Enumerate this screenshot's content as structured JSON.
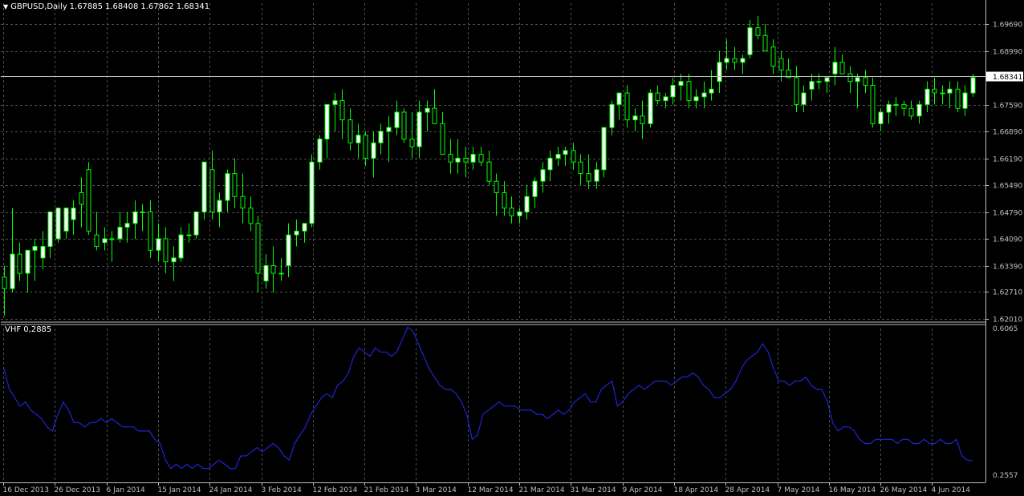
{
  "header": {
    "menu_icon": "triangle-down-icon",
    "symbol": "GBPUSD,Daily",
    "open": "1.67885",
    "high": "1.68408",
    "low": "1.67862",
    "close": "1.68341"
  },
  "indicator": {
    "name": "VHF",
    "value": "0.2885",
    "label": "VHF 0,2885",
    "scale_top": "0.6065",
    "scale_bottom": "0.2557"
  },
  "colors": {
    "background": "#000000",
    "grid": "#4f4f4f",
    "axis": "#c0c0c0",
    "candle_up": "#ffffff",
    "candle_down": "#000000",
    "wick": "#00ff00",
    "bid_line": "#c0c0c0",
    "indicator_line": "#2323d2",
    "price_label_bg": "#ffffff"
  },
  "price_axis": {
    "ticks": [
      "1.69690",
      "1.68990",
      "1.67590",
      "1.66890",
      "1.66190",
      "1.65490",
      "1.64790",
      "1.64090",
      "1.63390",
      "1.62710",
      "1.62010"
    ],
    "current_price_label": "1.68341"
  },
  "time_axis": {
    "labels": [
      "16 Dec 2013",
      "26 Dec 2013",
      "6 Jan 2014",
      "15 Jan 2014",
      "24 Jan 2014",
      "3 Feb 2014",
      "12 Feb 2014",
      "21 Feb 2014",
      "3 Mar 2014",
      "12 Mar 2014",
      "21 Mar 2014",
      "31 Mar 2014",
      "9 Apr 2014",
      "18 Apr 2014",
      "28 Apr 2014",
      "7 May 2014",
      "16 May 2014",
      "26 May 2014",
      "4 Jun 2014"
    ]
  },
  "chart_data": [
    {
      "type": "candlestick",
      "title": "GBPUSD,Daily",
      "ylim": [
        1.6201,
        1.6999
      ],
      "current_price": 1.68341,
      "grid": true,
      "candles": [
        [
          1.631,
          1.634,
          1.621,
          1.628
        ],
        [
          1.628,
          1.649,
          1.627,
          1.637
        ],
        [
          1.637,
          1.64,
          1.63,
          1.632
        ],
        [
          1.632,
          1.636,
          1.627,
          1.638
        ],
        [
          1.638,
          1.641,
          1.63,
          1.639
        ],
        [
          1.636,
          1.643,
          1.633,
          1.639
        ],
        [
          1.639,
          1.645,
          1.636,
          1.648
        ],
        [
          1.641,
          1.648,
          1.64,
          1.649
        ],
        [
          1.643,
          1.646,
          1.641,
          1.649
        ],
        [
          1.646,
          1.651,
          1.642,
          1.649
        ],
        [
          1.653,
          1.657,
          1.644,
          1.65
        ],
        [
          1.659,
          1.661,
          1.642,
          1.643
        ],
        [
          1.642,
          1.648,
          1.638,
          1.639
        ],
        [
          1.64,
          1.644,
          1.638,
          1.641
        ],
        [
          1.641,
          1.643,
          1.635,
          1.641
        ],
        [
          1.641,
          1.648,
          1.64,
          1.644
        ],
        [
          1.644,
          1.648,
          1.64,
          1.645
        ],
        [
          1.645,
          1.651,
          1.641,
          1.648
        ],
        [
          1.648,
          1.65,
          1.643,
          1.648
        ],
        [
          1.648,
          1.651,
          1.636,
          1.638
        ],
        [
          1.638,
          1.645,
          1.635,
          1.641
        ],
        [
          1.641,
          1.644,
          1.632,
          1.635
        ],
        [
          1.635,
          1.639,
          1.63,
          1.636
        ],
        [
          1.636,
          1.644,
          1.635,
          1.642
        ],
        [
          1.642,
          1.645,
          1.64,
          1.642
        ],
        [
          1.642,
          1.647,
          1.641,
          1.648
        ],
        [
          1.648,
          1.661,
          1.646,
          1.661
        ],
        [
          1.659,
          1.664,
          1.646,
          1.648
        ],
        [
          1.648,
          1.653,
          1.644,
          1.651
        ],
        [
          1.651,
          1.659,
          1.648,
          1.658
        ],
        [
          1.658,
          1.662,
          1.649,
          1.652
        ],
        [
          1.652,
          1.658,
          1.645,
          1.649
        ],
        [
          1.649,
          1.652,
          1.643,
          1.645
        ],
        [
          1.645,
          1.647,
          1.627,
          1.632
        ],
        [
          1.63,
          1.637,
          1.628,
          1.634
        ],
        [
          1.634,
          1.639,
          1.627,
          1.632
        ],
        [
          1.632,
          1.636,
          1.63,
          1.632
        ],
        [
          1.634,
          1.645,
          1.631,
          1.642
        ],
        [
          1.642,
          1.646,
          1.639,
          1.643
        ],
        [
          1.643,
          1.645,
          1.64,
          1.645
        ],
        [
          1.645,
          1.663,
          1.644,
          1.661
        ],
        [
          1.661,
          1.668,
          1.659,
          1.667
        ],
        [
          1.667,
          1.676,
          1.662,
          1.676
        ],
        [
          1.676,
          1.679,
          1.669,
          1.677
        ],
        [
          1.677,
          1.68,
          1.667,
          1.672
        ],
        [
          1.672,
          1.675,
          1.664,
          1.666
        ],
        [
          1.666,
          1.671,
          1.662,
          1.668
        ],
        [
          1.668,
          1.669,
          1.66,
          1.662
        ],
        [
          1.662,
          1.669,
          1.657,
          1.666
        ],
        [
          1.666,
          1.671,
          1.663,
          1.669
        ],
        [
          1.669,
          1.673,
          1.661,
          1.67
        ],
        [
          1.67,
          1.677,
          1.668,
          1.674
        ],
        [
          1.674,
          1.675,
          1.666,
          1.667
        ],
        [
          1.667,
          1.674,
          1.662,
          1.665
        ],
        [
          1.665,
          1.677,
          1.662,
          1.674
        ],
        [
          1.674,
          1.677,
          1.669,
          1.675
        ],
        [
          1.675,
          1.68,
          1.672,
          1.671
        ],
        [
          1.671,
          1.674,
          1.664,
          1.663
        ],
        [
          1.663,
          1.667,
          1.658,
          1.661
        ],
        [
          1.661,
          1.667,
          1.658,
          1.662
        ],
        [
          1.662,
          1.665,
          1.657,
          1.661
        ],
        [
          1.661,
          1.665,
          1.659,
          1.663
        ],
        [
          1.663,
          1.665,
          1.66,
          1.661
        ],
        [
          1.661,
          1.664,
          1.655,
          1.656
        ],
        [
          1.656,
          1.658,
          1.647,
          1.653
        ],
        [
          1.653,
          1.656,
          1.647,
          1.649
        ],
        [
          1.649,
          1.652,
          1.645,
          1.647
        ],
        [
          1.647,
          1.649,
          1.645,
          1.648
        ],
        [
          1.648,
          1.655,
          1.646,
          1.652
        ],
        [
          1.652,
          1.657,
          1.649,
          1.656
        ],
        [
          1.656,
          1.661,
          1.653,
          1.659
        ],
        [
          1.659,
          1.664,
          1.656,
          1.662
        ],
        [
          1.662,
          1.665,
          1.66,
          1.663
        ],
        [
          1.663,
          1.665,
          1.66,
          1.664
        ],
        [
          1.664,
          1.666,
          1.659,
          1.661
        ],
        [
          1.661,
          1.663,
          1.655,
          1.658
        ],
        [
          1.658,
          1.663,
          1.654,
          1.656
        ],
        [
          1.656,
          1.661,
          1.654,
          1.659
        ],
        [
          1.659,
          1.67,
          1.657,
          1.67
        ],
        [
          1.67,
          1.677,
          1.668,
          1.676
        ],
        [
          1.676,
          1.679,
          1.672,
          1.679
        ],
        [
          1.679,
          1.681,
          1.67,
          1.672
        ],
        [
          1.672,
          1.675,
          1.669,
          1.673
        ],
        [
          1.673,
          1.677,
          1.667,
          1.671
        ],
        [
          1.671,
          1.68,
          1.67,
          1.679
        ],
        [
          1.679,
          1.681,
          1.676,
          1.677
        ],
        [
          1.677,
          1.679,
          1.675,
          1.678
        ],
        [
          1.678,
          1.683,
          1.676,
          1.681
        ],
        [
          1.681,
          1.684,
          1.677,
          1.682
        ],
        [
          1.682,
          1.684,
          1.675,
          1.677
        ],
        [
          1.677,
          1.68,
          1.675,
          1.678
        ],
        [
          1.678,
          1.682,
          1.675,
          1.679
        ],
        [
          1.679,
          1.685,
          1.677,
          1.68
        ],
        [
          1.682,
          1.69,
          1.679,
          1.687
        ],
        [
          1.687,
          1.693,
          1.685,
          1.688
        ],
        [
          1.688,
          1.691,
          1.685,
          1.687
        ],
        [
          1.687,
          1.689,
          1.684,
          1.688
        ],
        [
          1.689,
          1.698,
          1.688,
          1.696
        ],
        [
          1.696,
          1.699,
          1.693,
          1.694
        ],
        [
          1.694,
          1.697,
          1.69,
          1.69
        ],
        [
          1.691,
          1.693,
          1.684,
          1.686
        ],
        [
          1.688,
          1.69,
          1.682,
          1.685
        ],
        [
          1.685,
          1.688,
          1.683,
          1.683
        ],
        [
          1.683,
          1.686,
          1.674,
          1.676
        ],
        [
          1.676,
          1.681,
          1.674,
          1.679
        ],
        [
          1.68,
          1.684,
          1.677,
          1.682
        ],
        [
          1.682,
          1.684,
          1.68,
          1.682
        ],
        [
          1.682,
          1.683,
          1.679,
          1.683
        ],
        [
          1.684,
          1.691,
          1.681,
          1.687
        ],
        [
          1.687,
          1.689,
          1.684,
          1.684
        ],
        [
          1.684,
          1.686,
          1.679,
          1.682
        ],
        [
          1.682,
          1.684,
          1.675,
          1.683
        ],
        [
          1.683,
          1.685,
          1.679,
          1.681
        ],
        [
          1.681,
          1.683,
          1.67,
          1.671
        ],
        [
          1.671,
          1.675,
          1.669,
          1.674
        ],
        [
          1.674,
          1.677,
          1.671,
          1.676
        ],
        [
          1.676,
          1.678,
          1.673,
          1.676
        ],
        [
          1.676,
          1.677,
          1.673,
          1.675
        ],
        [
          1.675,
          1.677,
          1.672,
          1.673
        ],
        [
          1.673,
          1.677,
          1.671,
          1.676
        ],
        [
          1.676,
          1.682,
          1.674,
          1.68
        ],
        [
          1.68,
          1.683,
          1.676,
          1.679
        ],
        [
          1.679,
          1.681,
          1.676,
          1.679
        ],
        [
          1.679,
          1.682,
          1.675,
          1.68
        ],
        [
          1.68,
          1.682,
          1.674,
          1.675
        ],
        [
          1.675,
          1.681,
          1.673,
          1.679
        ],
        [
          1.679,
          1.684,
          1.678,
          1.683
        ]
      ]
    },
    {
      "type": "line",
      "title": "VHF 0,2885",
      "ylim": [
        0.2557,
        0.6065
      ],
      "series": [
        {
          "name": "VHF",
          "values": [
            0.51,
            0.46,
            0.44,
            0.42,
            0.43,
            0.41,
            0.4,
            0.39,
            0.37,
            0.36,
            0.4,
            0.43,
            0.41,
            0.38,
            0.38,
            0.37,
            0.38,
            0.38,
            0.39,
            0.38,
            0.39,
            0.38,
            0.37,
            0.37,
            0.37,
            0.36,
            0.36,
            0.36,
            0.34,
            0.33,
            0.29,
            0.27,
            0.28,
            0.27,
            0.28,
            0.27,
            0.28,
            0.27,
            0.27,
            0.28,
            0.29,
            0.28,
            0.27,
            0.27,
            0.3,
            0.3,
            0.31,
            0.32,
            0.31,
            0.32,
            0.33,
            0.32,
            0.3,
            0.29,
            0.33,
            0.35,
            0.37,
            0.4,
            0.42,
            0.44,
            0.45,
            0.44,
            0.47,
            0.48,
            0.5,
            0.54,
            0.56,
            0.55,
            0.54,
            0.56,
            0.55,
            0.55,
            0.54,
            0.55,
            0.58,
            0.61,
            0.6,
            0.57,
            0.54,
            0.51,
            0.49,
            0.47,
            0.46,
            0.46,
            0.45,
            0.43,
            0.4,
            0.34,
            0.35,
            0.4,
            0.41,
            0.42,
            0.43,
            0.42,
            0.42,
            0.42,
            0.41,
            0.41,
            0.41,
            0.4,
            0.4,
            0.39,
            0.4,
            0.41,
            0.4,
            0.41,
            0.43,
            0.44,
            0.45,
            0.43,
            0.43,
            0.46,
            0.47,
            0.48,
            0.42,
            0.43,
            0.45,
            0.46,
            0.47,
            0.46,
            0.47,
            0.48,
            0.48,
            0.48,
            0.47,
            0.48,
            0.49,
            0.49,
            0.5,
            0.49,
            0.47,
            0.46,
            0.44,
            0.44,
            0.45,
            0.46,
            0.48,
            0.51,
            0.53,
            0.54,
            0.55,
            0.57,
            0.55,
            0.51,
            0.48,
            0.48,
            0.47,
            0.48,
            0.48,
            0.49,
            0.47,
            0.46,
            0.46,
            0.43,
            0.38,
            0.36,
            0.37,
            0.37,
            0.36,
            0.34,
            0.33,
            0.33,
            0.34,
            0.34,
            0.34,
            0.34,
            0.33,
            0.34,
            0.34,
            0.33,
            0.33,
            0.34,
            0.33,
            0.33,
            0.34,
            0.33,
            0.33,
            0.34,
            0.3,
            0.29,
            0.2885
          ]
        }
      ]
    }
  ]
}
